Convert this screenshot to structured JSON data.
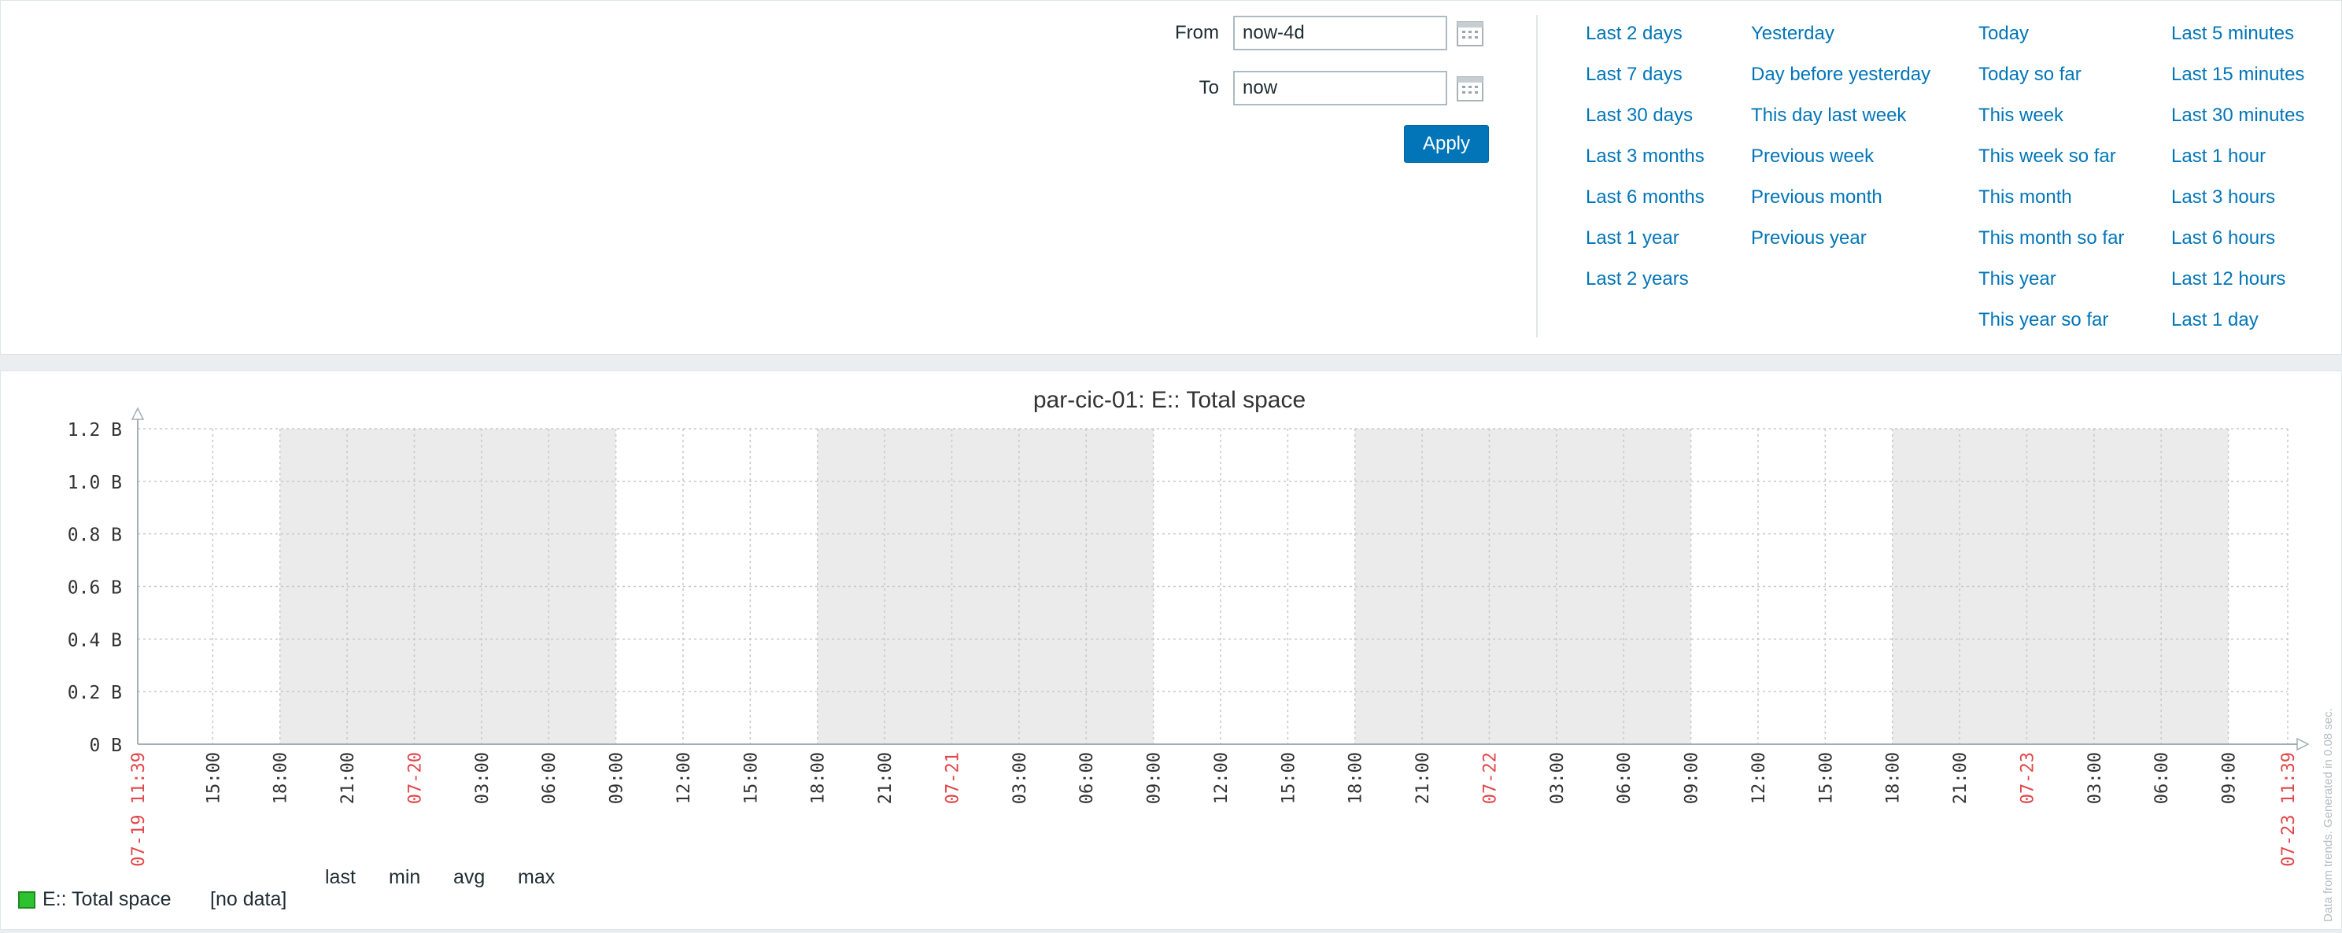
{
  "filter": {
    "from_label": "From",
    "from_value": "now-4d",
    "to_label": "To",
    "to_value": "now",
    "apply_label": "Apply"
  },
  "quick_ranges": [
    [
      "Last 2 days",
      "Last 7 days",
      "Last 30 days",
      "Last 3 months",
      "Last 6 months",
      "Last 1 year",
      "Last 2 years"
    ],
    [
      "Yesterday",
      "Day before yesterday",
      "This day last week",
      "Previous week",
      "Previous month",
      "Previous year"
    ],
    [
      "Today",
      "Today so far",
      "This week",
      "This week so far",
      "This month",
      "This month so far",
      "This year",
      "This year so far"
    ],
    [
      "Last 5 minutes",
      "Last 15 minutes",
      "Last 30 minutes",
      "Last 1 hour",
      "Last 3 hours",
      "Last 6 hours",
      "Last 12 hours",
      "Last 1 day"
    ]
  ],
  "graph": {
    "title": "par-cic-01: E:: Total space",
    "side_note": "Data from trends. Generated in 0.08 sec.",
    "y_ticks": [
      "0 B",
      "0.2 B",
      "0.4 B",
      "0.6 B",
      "0.8 B",
      "1.0 B",
      "1.2 B"
    ],
    "x_ticks": [
      {
        "label": "07-19 11:39",
        "type": "edge"
      },
      {
        "label": "15:00",
        "type": "time"
      },
      {
        "label": "18:00",
        "type": "time"
      },
      {
        "label": "21:00",
        "type": "time"
      },
      {
        "label": "07-20",
        "type": "date"
      },
      {
        "label": "03:00",
        "type": "time"
      },
      {
        "label": "06:00",
        "type": "time"
      },
      {
        "label": "09:00",
        "type": "time"
      },
      {
        "label": "12:00",
        "type": "time"
      },
      {
        "label": "15:00",
        "type": "time"
      },
      {
        "label": "18:00",
        "type": "time"
      },
      {
        "label": "21:00",
        "type": "time"
      },
      {
        "label": "07-21",
        "type": "date"
      },
      {
        "label": "03:00",
        "type": "time"
      },
      {
        "label": "06:00",
        "type": "time"
      },
      {
        "label": "09:00",
        "type": "time"
      },
      {
        "label": "12:00",
        "type": "time"
      },
      {
        "label": "15:00",
        "type": "time"
      },
      {
        "label": "18:00",
        "type": "time"
      },
      {
        "label": "21:00",
        "type": "time"
      },
      {
        "label": "07-22",
        "type": "date"
      },
      {
        "label": "03:00",
        "type": "time"
      },
      {
        "label": "06:00",
        "type": "time"
      },
      {
        "label": "09:00",
        "type": "time"
      },
      {
        "label": "12:00",
        "type": "time"
      },
      {
        "label": "15:00",
        "type": "time"
      },
      {
        "label": "18:00",
        "type": "time"
      },
      {
        "label": "21:00",
        "type": "time"
      },
      {
        "label": "07-23",
        "type": "date"
      },
      {
        "label": "03:00",
        "type": "time"
      },
      {
        "label": "06:00",
        "type": "time"
      },
      {
        "label": "09:00",
        "type": "time"
      },
      {
        "label": "07-23 11:39",
        "type": "edge"
      }
    ],
    "legend": {
      "header_last": "last",
      "header_min": "min",
      "header_avg": "avg",
      "header_max": "max",
      "item_name": "E:: Total space",
      "item_status": "[no data]",
      "item_color": "#2ec22e"
    },
    "colors": {
      "night_band": "#ebebeb",
      "date_label": "#e0484b",
      "link": "#0275b8",
      "accent_button": "#0275b8"
    }
  },
  "chart_data": {
    "type": "line",
    "title": "par-cic-01: E:: Total space",
    "x_start": "07-19 11:39",
    "x_end": "07-23 11:39",
    "ylim": [
      0,
      1.2
    ],
    "y_unit": "B",
    "series": [
      {
        "name": "E:: Total space",
        "values": []
      }
    ],
    "night_bands": [
      [
        "07-19 18:00",
        "07-20 09:00"
      ],
      [
        "07-20 18:00",
        "07-21 09:00"
      ],
      [
        "07-21 18:00",
        "07-22 09:00"
      ],
      [
        "07-22 18:00",
        "07-23 09:00"
      ]
    ],
    "grid": true
  }
}
